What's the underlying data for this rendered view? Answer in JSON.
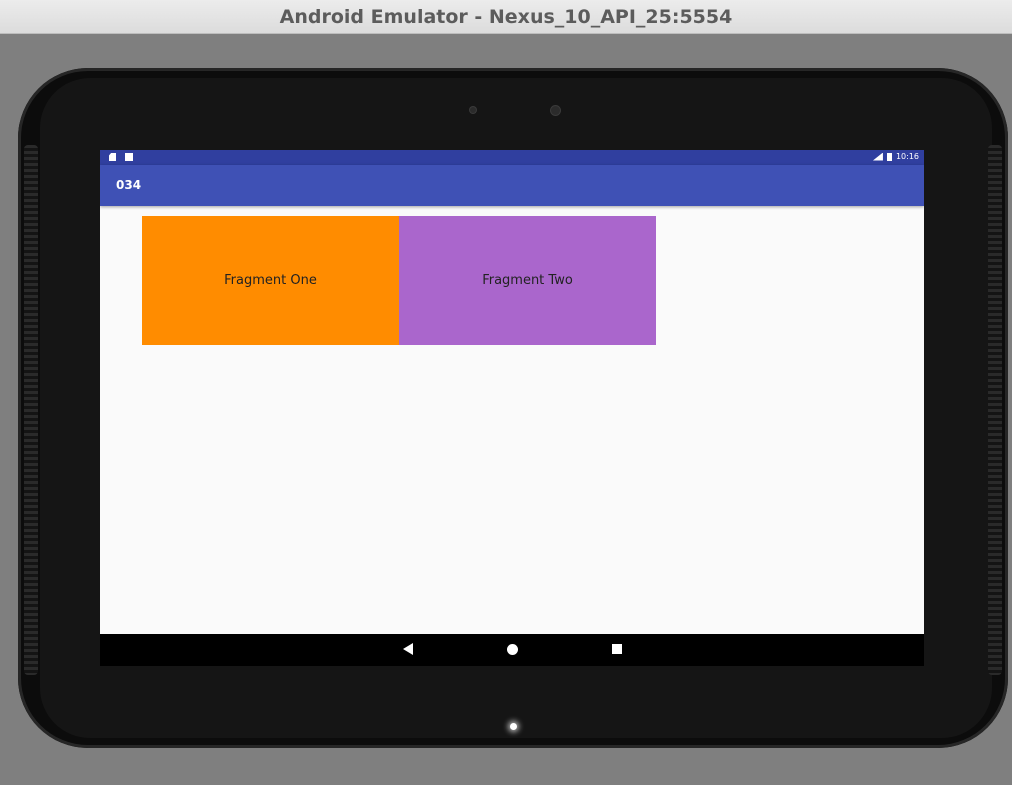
{
  "window": {
    "title": "Android Emulator - Nexus_10_API_25:5554"
  },
  "status_bar": {
    "time": "10:16",
    "left_icons": [
      "sd-card-icon",
      "android-notification-icon"
    ],
    "right_icons": [
      "signal-icon",
      "battery-icon"
    ]
  },
  "app_bar": {
    "title": "034"
  },
  "fragments": {
    "one": {
      "label": "Fragment One",
      "color": "#ff8c00"
    },
    "two": {
      "label": "Fragment Two",
      "color": "#aa66cc"
    }
  },
  "nav_bar": {
    "buttons": [
      "back-icon",
      "home-icon",
      "recents-icon"
    ]
  },
  "colors": {
    "status_bar": "#303f9f",
    "app_bar": "#3f51b5",
    "screen_bg": "#fafafa",
    "device": "#151515"
  }
}
